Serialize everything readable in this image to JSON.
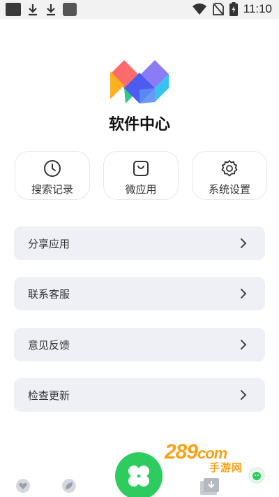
{
  "status_bar": {
    "time": "11:10"
  },
  "app": {
    "title": "软件中心"
  },
  "cards": [
    {
      "label": "搜索记录",
      "icon": "clock-icon"
    },
    {
      "label": "微应用",
      "icon": "bag-icon"
    },
    {
      "label": "系统设置",
      "icon": "gear-icon"
    }
  ],
  "menu": [
    {
      "label": "分享应用"
    },
    {
      "label": "联系客服"
    },
    {
      "label": "意见反馈"
    },
    {
      "label": "检查更新"
    }
  ],
  "watermark": {
    "text": "289",
    "suffix": "com",
    "sub": "手游网"
  },
  "colors": {
    "accent_green": "#2ecc5e",
    "row_bg": "#eef0f5",
    "watermark_orange": "#f7a21b"
  }
}
